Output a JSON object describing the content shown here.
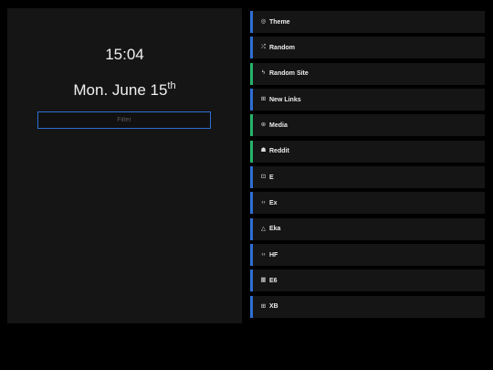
{
  "clock": {
    "time": "15:04",
    "date_main": "Mon. June 15",
    "date_suffix": "th"
  },
  "filter": {
    "placeholder": "Filter",
    "value": ""
  },
  "links": [
    {
      "label": "Theme",
      "icon": "palette-icon",
      "glyph": "◎",
      "accent": "#2f6fd4"
    },
    {
      "label": "Random",
      "icon": "shuffle-icon",
      "glyph": "⤮",
      "accent": "#2f6fd4"
    },
    {
      "label": "Random Site",
      "icon": "bolt-icon",
      "glyph": "ϟ",
      "accent": "#25b36a"
    },
    {
      "label": "New Links",
      "icon": "plus-square-icon",
      "glyph": "⊞",
      "accent": "#2f6fd4"
    },
    {
      "label": "Media",
      "icon": "play-circle-icon",
      "glyph": "⊛",
      "accent": "#25b36a"
    },
    {
      "label": "Reddit",
      "icon": "reddit-icon",
      "glyph": "☗",
      "accent": "#25b36a"
    },
    {
      "label": "E",
      "icon": "image-icon",
      "glyph": "⊡",
      "accent": "#2f6fd4"
    },
    {
      "label": "Ex",
      "icon": "code-icon",
      "glyph": "‹›",
      "accent": "#2f6fd4"
    },
    {
      "label": "Eka",
      "icon": "warning-icon",
      "glyph": "△",
      "accent": "#2f6fd4"
    },
    {
      "label": "HF",
      "icon": "code-icon",
      "glyph": "‹›",
      "accent": "#2f6fd4"
    },
    {
      "label": "E6",
      "icon": "grid-icon",
      "glyph": "▦",
      "accent": "#2f6fd4"
    },
    {
      "label": "XB",
      "icon": "plus-box-icon",
      "glyph": "⊞",
      "accent": "#2f6fd4"
    }
  ]
}
